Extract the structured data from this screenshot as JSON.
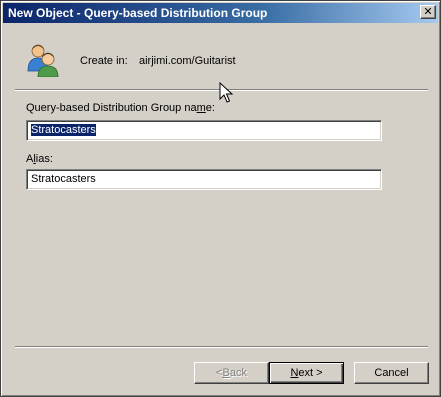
{
  "window": {
    "title": "New Object - Query-based Distribution Group",
    "close_glyph": "✕"
  },
  "header": {
    "icon": "users-group-icon",
    "create_in_label": "Create in:",
    "create_in_path": "airjimi.com/Guitarist"
  },
  "form": {
    "group_name_label_pre": "Query-based Distribution Group na",
    "group_name_label_key": "m",
    "group_name_label_post": "e:",
    "group_name_value": "Stratocasters",
    "alias_label_pre": "A",
    "alias_label_key": "l",
    "alias_label_post": "ias:",
    "alias_value": "Stratocasters"
  },
  "buttons": {
    "back_pre": "< ",
    "back_key": "B",
    "back_post": "ack",
    "back_enabled": false,
    "next_key": "N",
    "next_post": "ext >",
    "cancel": "Cancel"
  },
  "colors": {
    "title_bar_start": "#0a246a",
    "title_bar_end": "#a6caf0",
    "dialog_face": "#d4d0c8",
    "selection": "#0a246a"
  }
}
